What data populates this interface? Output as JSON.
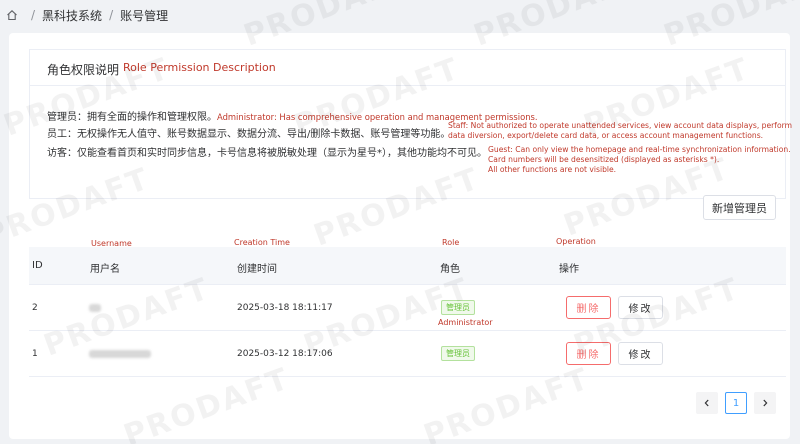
{
  "breadcrumb": {
    "home_icon": "home-icon",
    "items": [
      "黑科技系统",
      "账号管理"
    ],
    "separator": "/"
  },
  "permissions": {
    "title": "角色权限说明",
    "title_en": "Role Permission Description",
    "admin_label": "管理员：拥有全面的操作和管理权限。",
    "admin_en": "Administrator: Has comprehensive operation and management permissions.",
    "staff_label": "员工：无权操作无人值守、账号数据显示、数据分流、导出/删除卡数据、账号管理等功能。",
    "staff_en_line1": "Staff: Not authorized to operate unattended services, view account data displays, perform",
    "staff_en_line2": "data diversion, export/delete card data, or access account management functions.",
    "guest_label": "访客：仅能查看首页和实时同步信息，卡号信息将被脱敏处理（显示为星号*），其他功能均不可见。",
    "guest_en_line1": "Guest: Can only view the homepage and real-time synchronization information.",
    "guest_en_line2": "Card numbers will be desensitized (displayed as asterisks *).",
    "guest_en_line3": "All other functions are not visible."
  },
  "toolbar": {
    "add_admin_label": "新增管理员"
  },
  "table": {
    "annotations": {
      "username": "Username",
      "creation_time": "Creation Time",
      "role": "Role",
      "operation": "Operation"
    },
    "headers": {
      "id": "ID",
      "username": "用户名",
      "created": "创建时间",
      "role": "角色",
      "actions": "操作"
    },
    "rows": [
      {
        "id": "2",
        "username_hidden": true,
        "created": "2025-03-18 18:11:17",
        "role": "管理员",
        "role_en": "Administrator",
        "delete_label": "删除",
        "edit_label": "修改"
      },
      {
        "id": "1",
        "username_hidden": true,
        "created": "2025-03-12 18:17:06",
        "role": "管理员",
        "role_en": "",
        "delete_label": "删除",
        "edit_label": "修改"
      }
    ]
  },
  "pagination": {
    "prev_icon": "chevron-left-icon",
    "current_page": "1",
    "next_icon": "chevron-right-icon"
  },
  "watermark": "PRODAFT",
  "colors": {
    "annotation_red": "#c0392b",
    "danger": "#f56c6c",
    "primary": "#409eff",
    "success": "#67c23a"
  }
}
